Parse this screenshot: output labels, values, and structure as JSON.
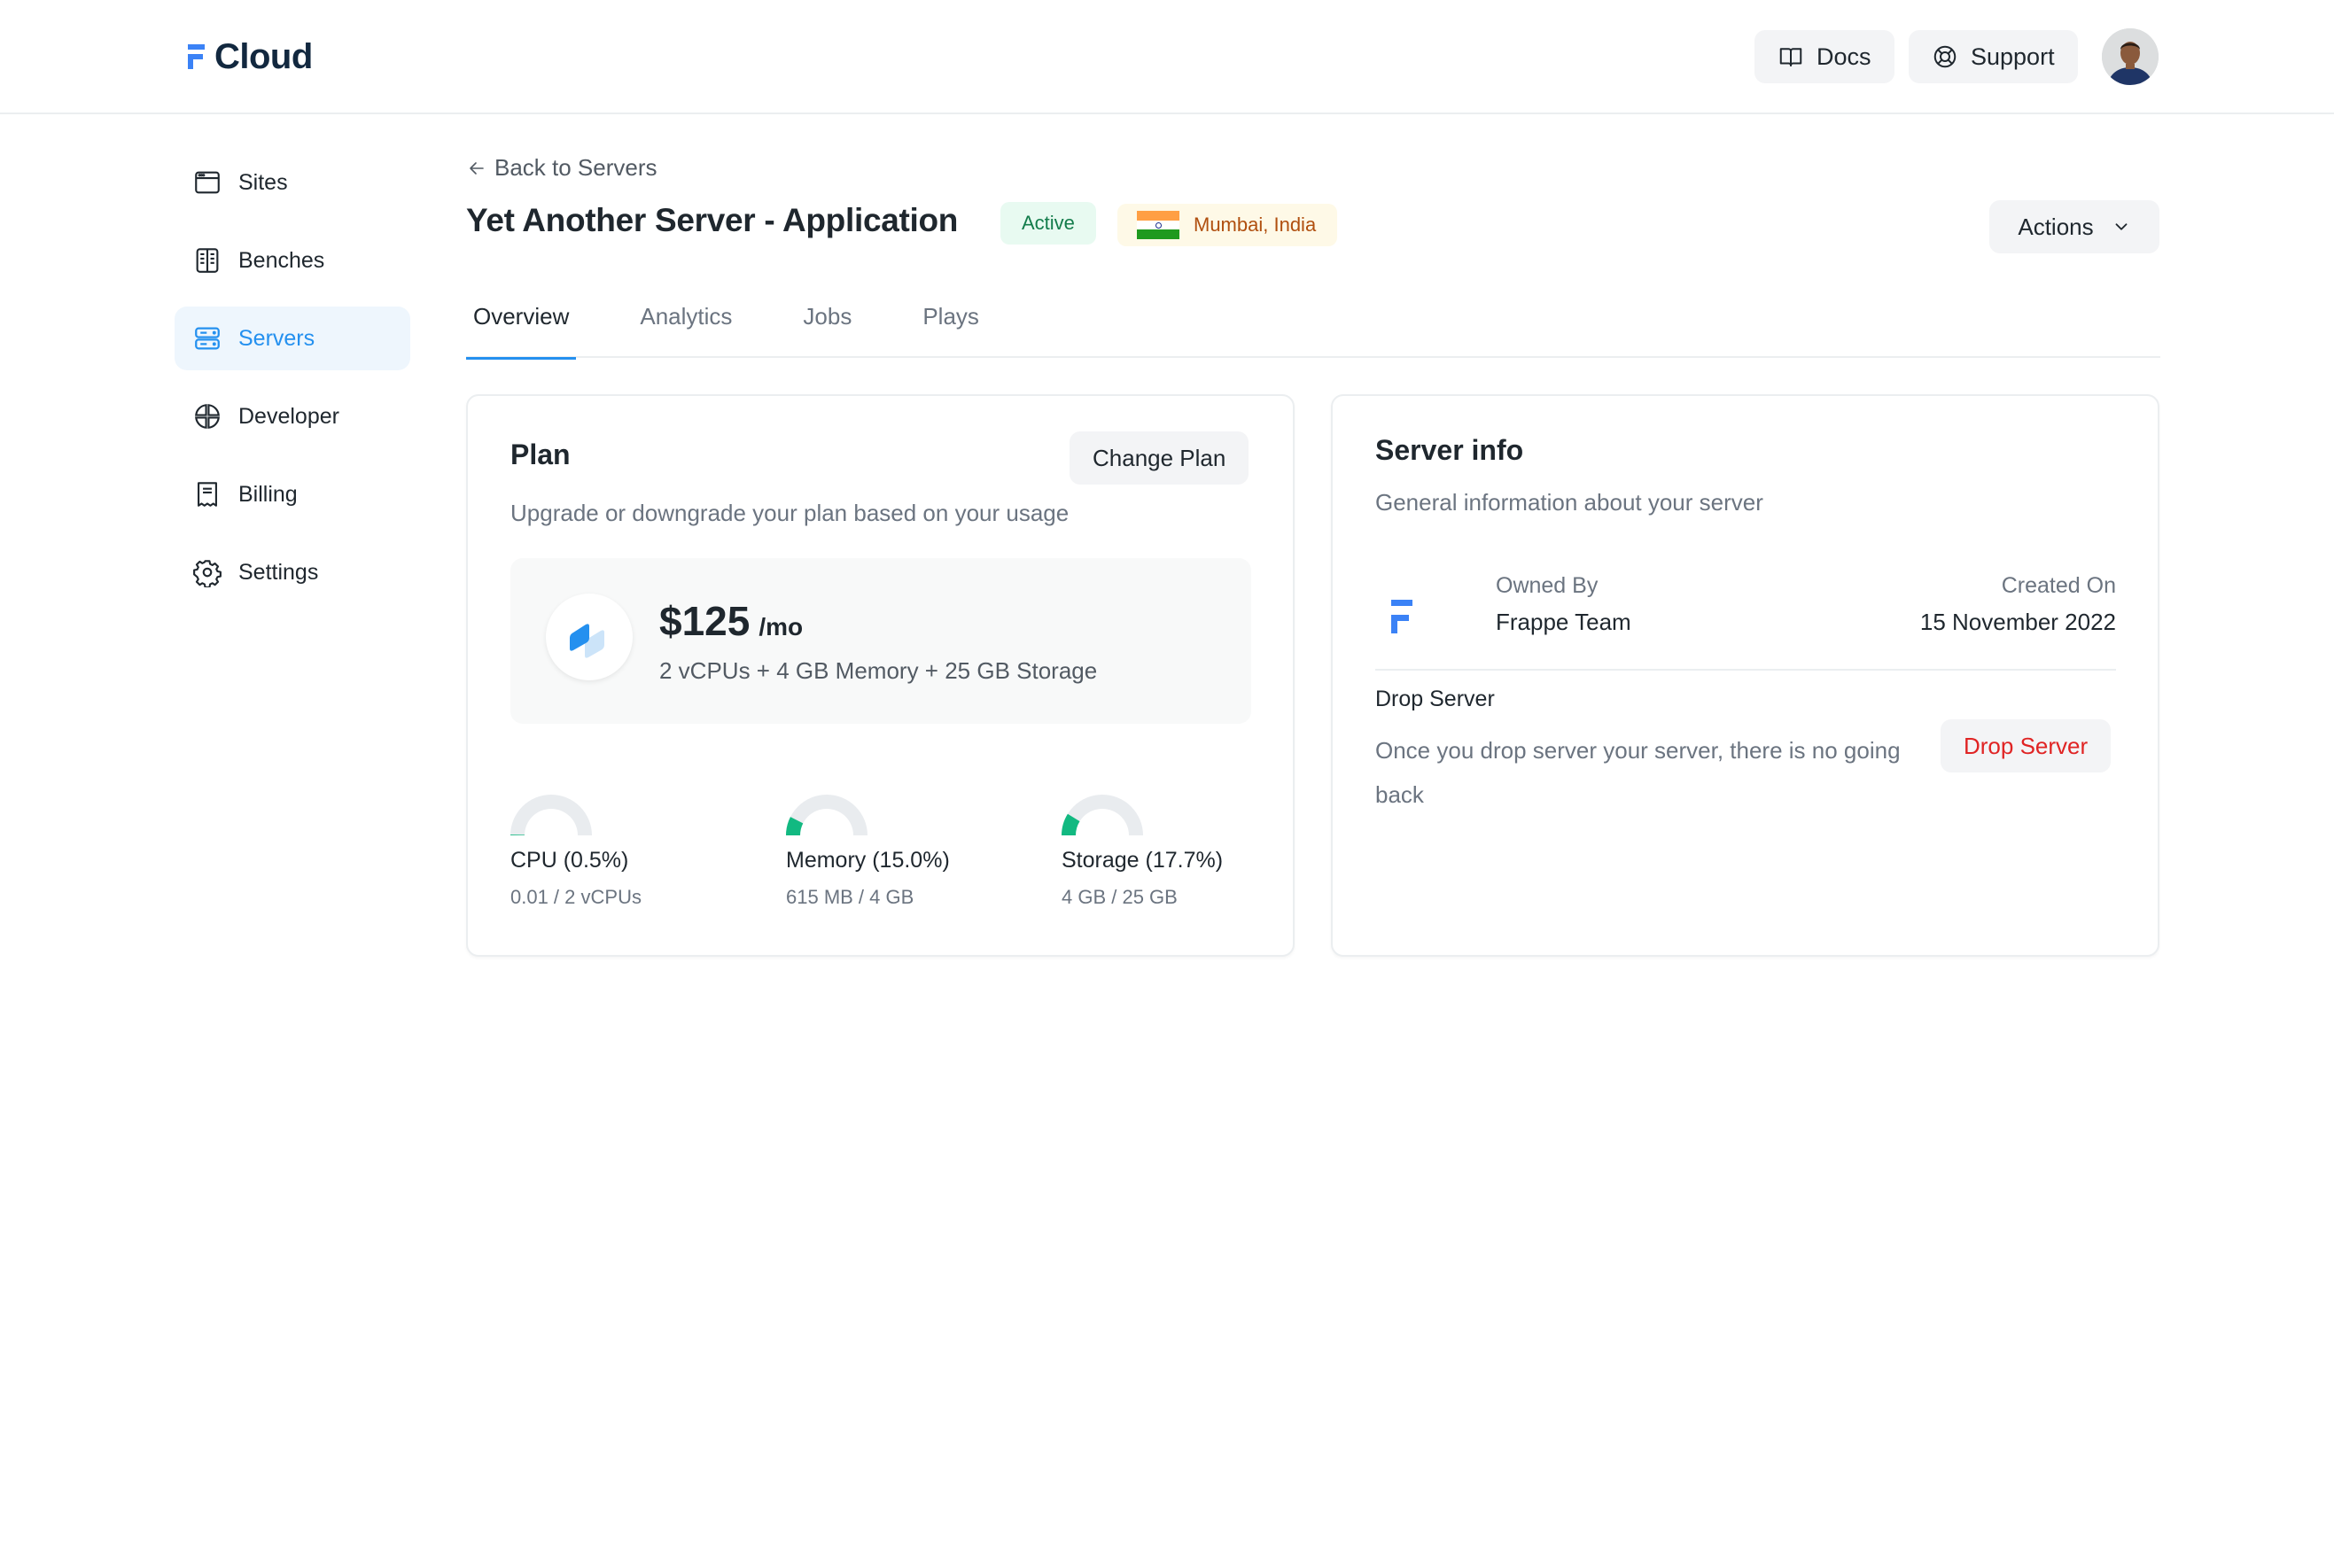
{
  "header": {
    "logo_text": "Cloud",
    "docs_label": "Docs",
    "support_label": "Support",
    "avatar_alt": "User avatar"
  },
  "sidebar": {
    "items": [
      {
        "label": "Sites",
        "icon": "browser-window-icon",
        "active": false
      },
      {
        "label": "Benches",
        "icon": "panels-icon",
        "active": false
      },
      {
        "label": "Servers",
        "icon": "server-icon",
        "active": true
      },
      {
        "label": "Developer",
        "icon": "globe-grid-icon",
        "active": false
      },
      {
        "label": "Billing",
        "icon": "receipt-icon",
        "active": false
      },
      {
        "label": "Settings",
        "icon": "gear-icon",
        "active": false
      }
    ]
  },
  "page": {
    "back_label": "Back to Servers",
    "title": "Yet Another Server - Application",
    "status_badge": "Active",
    "region": "Mumbai, India",
    "actions_label": "Actions"
  },
  "tabs": [
    {
      "label": "Overview",
      "active": true
    },
    {
      "label": "Analytics",
      "active": false
    },
    {
      "label": "Jobs",
      "active": false
    },
    {
      "label": "Plays",
      "active": false
    }
  ],
  "plan_card": {
    "title": "Plan",
    "change_plan_label": "Change Plan",
    "subtitle": "Upgrade or downgrade your plan based on your usage",
    "price": "$125",
    "period": "/mo",
    "specs": "2 vCPUs + 4 GB Memory + 25 GB Storage",
    "usage": [
      {
        "label": "CPU (0.5%)",
        "detail": "0.01 / 2 vCPUs",
        "percent": 0.5
      },
      {
        "label": "Memory (15.0%)",
        "detail": "615 MB / 4 GB",
        "percent": 15.0
      },
      {
        "label": "Storage (17.7%)",
        "detail": "4 GB / 25 GB",
        "percent": 17.7
      }
    ]
  },
  "info_card": {
    "title": "Server info",
    "subtitle": "General information about your server",
    "owned_by_label": "Owned By",
    "owned_by_value": "Frappe Team",
    "created_on_label": "Created On",
    "created_on_value": "15 November 2022",
    "drop_title": "Drop Server",
    "drop_description": "Once you drop server your server, there is no going back",
    "drop_button_label": "Drop Server"
  },
  "colors": {
    "accent": "#2490ef",
    "logo_blue": "#3b82f6",
    "gauge_fill": "#12b981",
    "gauge_track": "#e9ecef",
    "danger": "#e02424",
    "active_badge_bg": "#e8faf1",
    "active_badge_text": "#137c4b",
    "region_badge_bg": "#fef9e7",
    "region_badge_text": "#b04f0f"
  }
}
